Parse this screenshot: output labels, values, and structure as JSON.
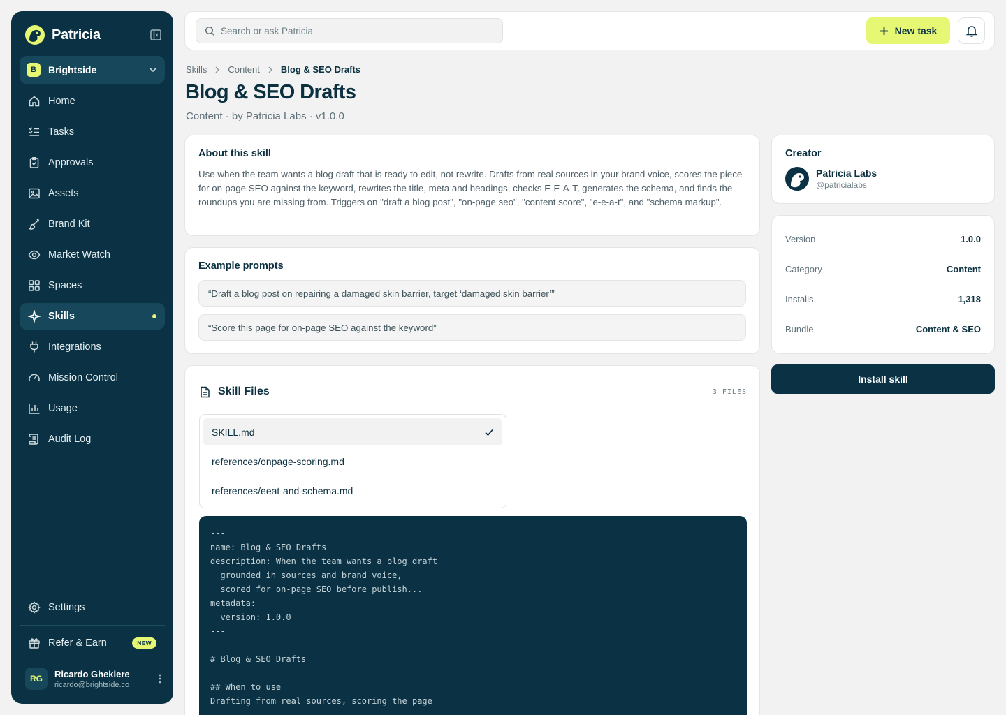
{
  "app": {
    "name": "Patricia"
  },
  "workspace": {
    "initial": "B",
    "name": "Brightside"
  },
  "nav": {
    "items": [
      {
        "label": "Home"
      },
      {
        "label": "Tasks"
      },
      {
        "label": "Approvals"
      },
      {
        "label": "Assets"
      },
      {
        "label": "Brand Kit"
      },
      {
        "label": "Market Watch"
      },
      {
        "label": "Spaces"
      },
      {
        "label": "Skills"
      },
      {
        "label": "Integrations"
      },
      {
        "label": "Mission Control"
      },
      {
        "label": "Usage"
      },
      {
        "label": "Audit Log"
      }
    ],
    "settings": "Settings",
    "refer": "Refer & Earn",
    "refer_badge": "NEW"
  },
  "user": {
    "initials": "RG",
    "name": "Ricardo Ghekiere",
    "email": "ricardo@brightside.co"
  },
  "topbar": {
    "search_placeholder": "Search or ask Patricia",
    "new_task": "New task"
  },
  "breadcrumb": [
    "Skills",
    "Content",
    "Blog & SEO Drafts"
  ],
  "page": {
    "title": "Blog & SEO Drafts",
    "subtitle": "Content · by Patricia Labs · v1.0.0"
  },
  "about": {
    "title": "About this skill",
    "text": "Use when the team wants a blog draft that is ready to edit, not rewrite. Drafts from real sources in your brand voice, scores the piece for on-page SEO against the keyword, rewrites the title, meta and headings, checks E-E-A-T, generates the schema, and finds the roundups you are missing from. Triggers on \"draft a blog post\", \"on-page seo\", \"content score\", \"e-e-a-t\", and \"schema markup\"."
  },
  "examples": {
    "title": "Example prompts",
    "prompts": [
      "“Draft a blog post on repairing a damaged skin barrier, target ‘damaged skin barrier’”",
      "“Score this page for on-page SEO against the keyword”"
    ]
  },
  "files": {
    "title": "Skill Files",
    "count": "3 FILES",
    "items": [
      "SKILL.md",
      "references/onpage-scoring.md",
      "references/eeat-and-schema.md"
    ],
    "code": "---\nname: Blog & SEO Drafts\ndescription: When the team wants a blog draft\n  grounded in sources and brand voice,\n  scored for on-page SEO before publish...\nmetadata:\n  version: 1.0.0\n---\n\n# Blog & SEO Drafts\n\n## When to use\nDrafting from real sources, scoring the page"
  },
  "creator": {
    "title": "Creator",
    "name": "Patricia Labs",
    "handle": "@patricialabs"
  },
  "meta": [
    {
      "label": "Version",
      "value": "1.0.0"
    },
    {
      "label": "Category",
      "value": "Content"
    },
    {
      "label": "Installs",
      "value": "1,318"
    },
    {
      "label": "Bundle",
      "value": "Content & SEO"
    }
  ],
  "install": "Install skill",
  "colors": {
    "sidebar": "#0b3244",
    "accent": "#e6f774",
    "background": "#f1f2f1"
  }
}
